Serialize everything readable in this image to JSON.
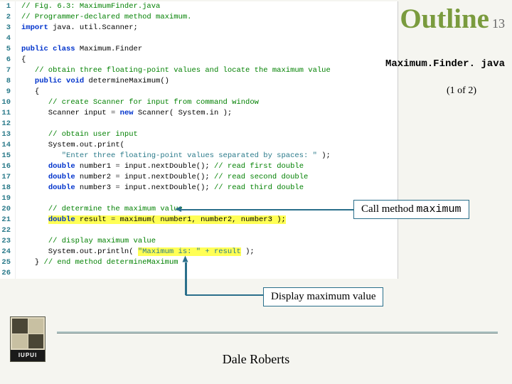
{
  "header": {
    "title": "Outline",
    "page_number": "13"
  },
  "filename": "Maximum.Finder. java",
  "pagination": "(1 of 2)",
  "code": {
    "lines": [
      {
        "n": "1",
        "segs": [
          {
            "t": "// Fig. 6.3: MaximumFinder.java",
            "c": "c-comment"
          }
        ]
      },
      {
        "n": "2",
        "segs": [
          {
            "t": "// Programmer-declared method maximum.",
            "c": "c-comment"
          }
        ]
      },
      {
        "n": "3",
        "segs": [
          {
            "t": "import",
            "c": "c-keyword"
          },
          {
            "t": " java. util.Scanner;",
            "c": "c-plain"
          }
        ]
      },
      {
        "n": "4",
        "segs": []
      },
      {
        "n": "5",
        "segs": [
          {
            "t": "public class",
            "c": "c-keyword"
          },
          {
            "t": " Maximum.Finder",
            "c": "c-plain"
          }
        ]
      },
      {
        "n": "6",
        "segs": [
          {
            "t": "{",
            "c": "c-plain"
          }
        ]
      },
      {
        "n": "7",
        "segs": [
          {
            "t": "   ",
            "c": "c-plain"
          },
          {
            "t": "// obtain three floating-point values and locate the maximum value",
            "c": "c-comment"
          }
        ]
      },
      {
        "n": "8",
        "segs": [
          {
            "t": "   ",
            "c": "c-plain"
          },
          {
            "t": "public void",
            "c": "c-keyword"
          },
          {
            "t": " determineMaximum()",
            "c": "c-plain"
          }
        ]
      },
      {
        "n": "9",
        "segs": [
          {
            "t": "   {",
            "c": "c-plain"
          }
        ]
      },
      {
        "n": "10",
        "segs": [
          {
            "t": "      ",
            "c": "c-plain"
          },
          {
            "t": "// create Scanner for input from command window",
            "c": "c-comment"
          }
        ]
      },
      {
        "n": "11",
        "segs": [
          {
            "t": "      Scanner input ",
            "c": "c-plain"
          },
          {
            "t": "=",
            "c": "c-op"
          },
          {
            "t": " ",
            "c": "c-plain"
          },
          {
            "t": "new",
            "c": "c-keyword"
          },
          {
            "t": " Scanner( System.in );",
            "c": "c-plain"
          }
        ]
      },
      {
        "n": "12",
        "segs": []
      },
      {
        "n": "13",
        "segs": [
          {
            "t": "      ",
            "c": "c-plain"
          },
          {
            "t": "// obtain user input",
            "c": "c-comment"
          }
        ]
      },
      {
        "n": "14",
        "segs": [
          {
            "t": "      System.out.print(",
            "c": "c-plain"
          }
        ]
      },
      {
        "n": "15",
        "segs": [
          {
            "t": "         ",
            "c": "c-plain"
          },
          {
            "t": "\"Enter three floating-point values separated by spaces: \"",
            "c": "c-string"
          },
          {
            "t": " );",
            "c": "c-plain"
          }
        ]
      },
      {
        "n": "16",
        "segs": [
          {
            "t": "      ",
            "c": "c-plain"
          },
          {
            "t": "double",
            "c": "c-keyword"
          },
          {
            "t": " number1 ",
            "c": "c-plain"
          },
          {
            "t": "=",
            "c": "c-op"
          },
          {
            "t": " input.nextDouble(); ",
            "c": "c-plain"
          },
          {
            "t": "// read first double",
            "c": "c-comment"
          }
        ]
      },
      {
        "n": "17",
        "segs": [
          {
            "t": "      ",
            "c": "c-plain"
          },
          {
            "t": "double",
            "c": "c-keyword"
          },
          {
            "t": " number2 ",
            "c": "c-plain"
          },
          {
            "t": "=",
            "c": "c-op"
          },
          {
            "t": " input.nextDouble(); ",
            "c": "c-plain"
          },
          {
            "t": "// read second double",
            "c": "c-comment"
          }
        ]
      },
      {
        "n": "18",
        "segs": [
          {
            "t": "      ",
            "c": "c-plain"
          },
          {
            "t": "double",
            "c": "c-keyword"
          },
          {
            "t": " number3 ",
            "c": "c-plain"
          },
          {
            "t": "=",
            "c": "c-op"
          },
          {
            "t": " input.nextDouble(); ",
            "c": "c-plain"
          },
          {
            "t": "// read third double",
            "c": "c-comment"
          }
        ]
      },
      {
        "n": "19",
        "segs": []
      },
      {
        "n": "20",
        "segs": [
          {
            "t": "      ",
            "c": "c-plain"
          },
          {
            "t": "// determine the maximum value",
            "c": "c-comment"
          }
        ]
      },
      {
        "n": "21",
        "segs": [
          {
            "t": "      ",
            "c": "c-plain"
          },
          {
            "t": "double",
            "c": "c-keyword hl"
          },
          {
            "t": " result ",
            "c": "c-plain hl"
          },
          {
            "t": "=",
            "c": "c-op hl"
          },
          {
            "t": " maximum( number1, number2, number3 );",
            "c": "c-plain hl"
          }
        ]
      },
      {
        "n": "22",
        "segs": []
      },
      {
        "n": "23",
        "segs": [
          {
            "t": "      ",
            "c": "c-plain"
          },
          {
            "t": "// display maximum value",
            "c": "c-comment"
          }
        ]
      },
      {
        "n": "24",
        "segs": [
          {
            "t": "      System.out.println( ",
            "c": "c-plain"
          },
          {
            "t": "\"Maximum is: \" + result",
            "c": "c-string hl"
          },
          {
            "t": " );",
            "c": "c-plain"
          }
        ]
      },
      {
        "n": "25",
        "segs": [
          {
            "t": "   } ",
            "c": "c-plain"
          },
          {
            "t": "// end method determineMaximum",
            "c": "c-comment"
          }
        ]
      },
      {
        "n": "26",
        "segs": []
      }
    ]
  },
  "callouts": {
    "call_method": {
      "pre": "Call method ",
      "mono": "maximum"
    },
    "display_max": "Display maximum value"
  },
  "logo_text": "IUPUI",
  "author": "Dale Roberts"
}
